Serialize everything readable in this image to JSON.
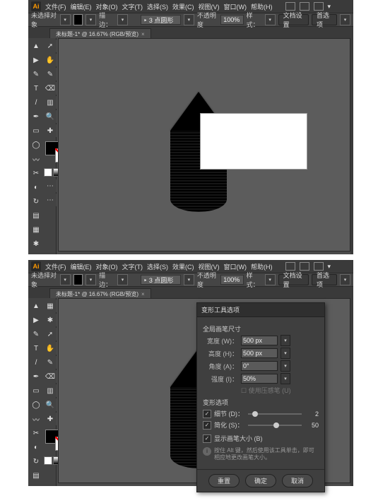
{
  "app": {
    "logo": "Ai"
  },
  "menu": [
    "文件(F)",
    "编辑(E)",
    "对象(O)",
    "文字(T)",
    "选择(S)",
    "效果(C)",
    "视图(V)",
    "窗口(W)",
    "帮助(H)"
  ],
  "controlbar": {
    "noselection": "未选择对象",
    "stroke_label": "描边：",
    "shape_preset": "‣ 3 点圆形",
    "opacity_label": "不透明度",
    "opacity_value": "100%",
    "style_label": "样式：",
    "docsetup": "文档设置",
    "prefs": "首选项"
  },
  "tab": {
    "title": "未标题-1* @ 16.67% (RGB/预览)",
    "close": "×"
  },
  "tool_glyphs": [
    "▲",
    "▶",
    "✎",
    "T",
    "/",
    "✒",
    "▭",
    "◯",
    "〰",
    "✂",
    "◐",
    "↻",
    "▤",
    "▦",
    "✱",
    "➚",
    "✋",
    "✎",
    "⌫",
    "▥",
    "🔍",
    "✚",
    "⋯",
    "⋯"
  ],
  "dialog": {
    "title": "变形工具选项",
    "sect1": "全局画笔尺寸",
    "width_l": "宽度 (W)：",
    "width_v": "500 px",
    "height_l": "高度 (H)：",
    "height_v": "500 px",
    "angle_l": "角度 (A)：",
    "angle_v": "0°",
    "intensity_l": "强度 (I)：",
    "intensity_v": "50%",
    "pressure_l": "☐ 使用压感笔 (U)",
    "sect2": "变形选项",
    "detail_l": "细节 (D)：",
    "detail_v": "2",
    "simplify_l": "简化 (S)：",
    "simplify_v": "50",
    "showsize_l": "显示画笔大小 (B)",
    "note": "按住 Alt 键，然后使用该工具单击，即可相应地更改画笔大小。",
    "reset": "重置",
    "ok": "确定",
    "cancel": "取消"
  }
}
